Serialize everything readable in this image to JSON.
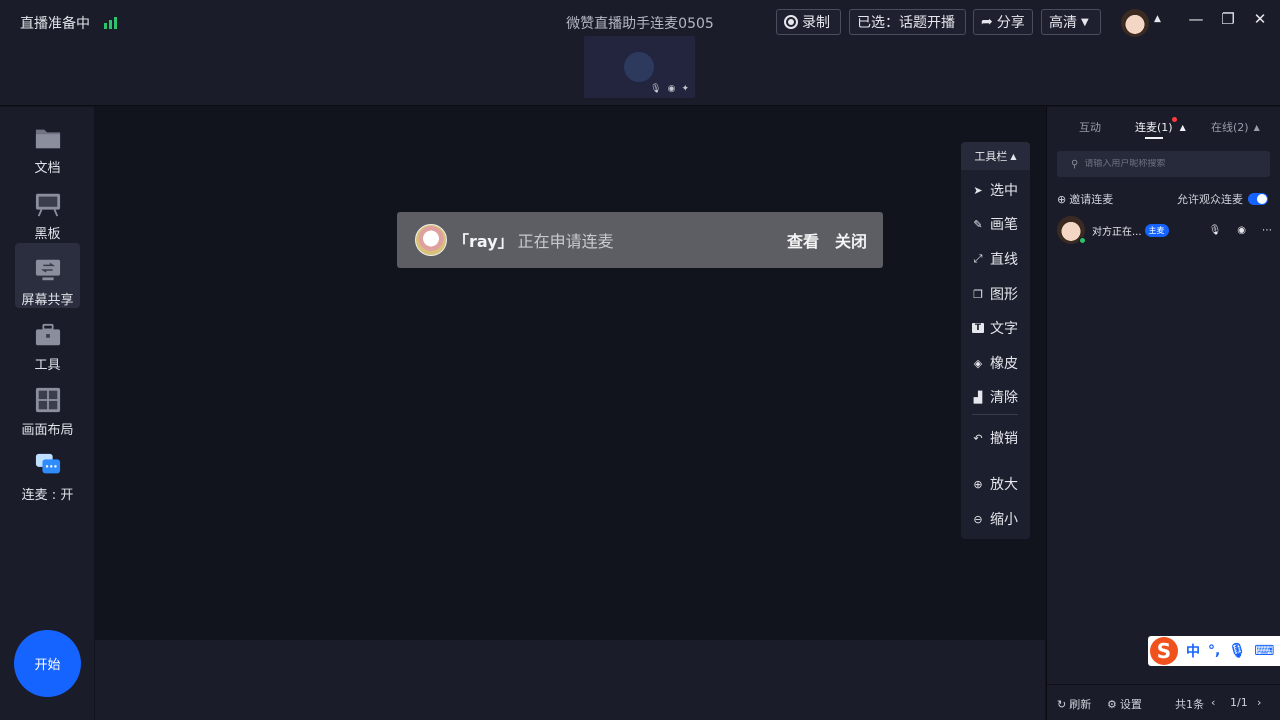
{
  "topbar": {
    "status": "直播准备中",
    "title": "微赞直播助手连麦0505",
    "record_label": "录制",
    "topic_label": "已选：话题开播",
    "share_label": "分享",
    "quality_label": "高清"
  },
  "sidebar": {
    "items": [
      {
        "label": "文档"
      },
      {
        "label": "黑板"
      },
      {
        "label": "屏幕共享"
      },
      {
        "label": "工具"
      },
      {
        "label": "画面布局"
      },
      {
        "label": "连麦 : 开"
      }
    ],
    "start_label": "开始"
  },
  "notification": {
    "name": "「ray」",
    "message": "正在申请连麦",
    "view_label": "查看",
    "close_label": "关闭"
  },
  "toolbar": {
    "header": "工具栏",
    "items": [
      {
        "label": "选中"
      },
      {
        "label": "画笔"
      },
      {
        "label": "直线"
      },
      {
        "label": "图形"
      },
      {
        "label": "文字"
      },
      {
        "label": "橡皮"
      },
      {
        "label": "清除"
      },
      {
        "label": "撤销"
      },
      {
        "label": "放大"
      },
      {
        "label": "缩小"
      }
    ]
  },
  "right_panel": {
    "tabs": {
      "interact": "互动",
      "mic": "连麦(1)",
      "online": "在线(2)"
    },
    "search_placeholder": "请输入用户昵称搜索",
    "invite_label": "邀请连麦",
    "allow_label": "允许观众连麦",
    "allow_enabled": true,
    "member": {
      "name": "对方正在...",
      "badge": "主麦"
    },
    "footer": {
      "refresh": "刷新",
      "settings": "设置",
      "total": "共1条",
      "page": "1/1"
    }
  },
  "ime": {
    "logo": "S",
    "lang": "中",
    "punct": "°,"
  }
}
